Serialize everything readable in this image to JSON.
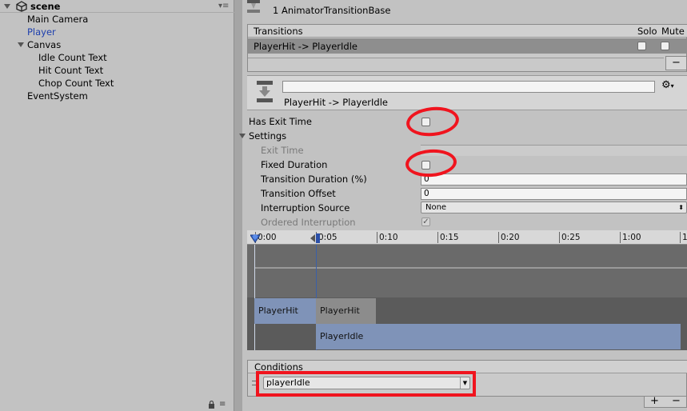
{
  "hierarchy": {
    "scene_name": "scene",
    "items": [
      {
        "label": "Main Camera"
      },
      {
        "label": "Player"
      },
      {
        "label": "Canvas"
      },
      {
        "label": "Idle Count Text"
      },
      {
        "label": "Hit Count Text"
      },
      {
        "label": "Chop Count Text"
      },
      {
        "label": "EventSystem"
      }
    ]
  },
  "inspector": {
    "header_title": "1 AnimatorTransitionBase",
    "transitions_header": "Transitions",
    "solo_label": "Solo",
    "mute_label": "Mute",
    "transition_row": "PlayerHit -> PlayerIdle",
    "name_field_value": "",
    "transition_name": "PlayerHit -> PlayerIdle",
    "has_exit_time_label": "Has Exit Time",
    "settings_label": "Settings",
    "exit_time_label": "Exit Time",
    "fixed_duration_label": "Fixed Duration",
    "transition_duration_label": "Transition Duration (%)",
    "transition_duration_value": "0",
    "transition_offset_label": "Transition Offset",
    "transition_offset_value": "0",
    "interruption_source_label": "Interruption Source",
    "interruption_source_value": "None",
    "ordered_interruption_label": "Ordered Interruption",
    "has_exit_time_checked": false,
    "fixed_duration_checked": false,
    "ordered_interruption_checked": true
  },
  "timeline": {
    "ticks": [
      "0:00",
      "0:05",
      "0:10",
      "0:15",
      "0:20",
      "0:25",
      "1:00",
      "1"
    ],
    "clip_a_top": "PlayerHit",
    "clip_a_bottom": "PlayerHit",
    "clip_b": "PlayerIdle"
  },
  "conditions": {
    "header": "Conditions",
    "param_value": "playerIdle",
    "add_label": "+",
    "remove_label": "−"
  },
  "colors": {
    "annotation": "#f0141e",
    "clip_blue": "#7f93b8",
    "clip_gray": "#8c8c8c"
  }
}
